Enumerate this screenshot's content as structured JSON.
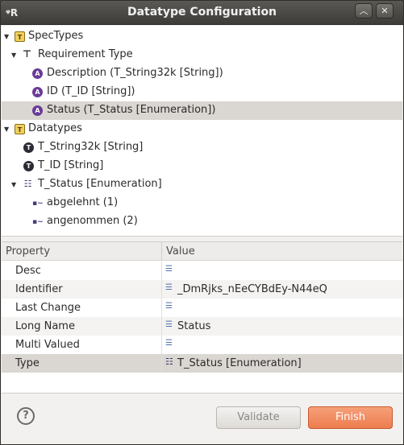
{
  "window": {
    "title": "Datatype Configuration",
    "app_icon_text": "ᵠR"
  },
  "tree": [
    {
      "label": "SpecTypes",
      "icon": "package-icon",
      "expanded": true,
      "depth": 0
    },
    {
      "label": "Requirement Type",
      "icon": "spec-type-icon",
      "expanded": true,
      "depth": 1
    },
    {
      "label": "Description (T_String32k [String])",
      "icon": "attribute-icon",
      "depth": 2
    },
    {
      "label": "ID (T_ID [String])",
      "icon": "attribute-icon",
      "depth": 2
    },
    {
      "label": "Status (T_Status [Enumeration])",
      "icon": "attribute-icon",
      "depth": 2,
      "selected": true
    },
    {
      "label": "Datatypes",
      "icon": "package-icon",
      "expanded": true,
      "depth": 0
    },
    {
      "label": "T_String32k [String]",
      "icon": "datatype-icon",
      "depth": 1
    },
    {
      "label": "T_ID [String]",
      "icon": "datatype-icon",
      "depth": 1
    },
    {
      "label": "T_Status [Enumeration]",
      "icon": "enumeration-icon",
      "expanded": true,
      "depth": 1
    },
    {
      "label": "abgelehnt (1)",
      "icon": "enum-value-icon",
      "depth": 2
    },
    {
      "label": "angenommen (2)",
      "icon": "enum-value-icon",
      "depth": 2
    }
  ],
  "properties": {
    "col_property": "Property",
    "col_value": "Value",
    "rows": [
      {
        "key": "Desc",
        "value": ""
      },
      {
        "key": "Identifier",
        "value": "_DmRjks_nEeCYBdEy-N44eQ"
      },
      {
        "key": "Last Change",
        "value": ""
      },
      {
        "key": "Long Name",
        "value": "Status"
      },
      {
        "key": "Multi Valued",
        "value": ""
      },
      {
        "key": "Type",
        "value": "T_Status [Enumeration]",
        "selected": true
      }
    ]
  },
  "buttons": {
    "help": "?",
    "validate": "Validate",
    "finish": "Finish"
  },
  "colors": {
    "finish_accent": "#ee7d4f",
    "selection": "#dad6d1",
    "titlebar": "#3d3c38"
  }
}
